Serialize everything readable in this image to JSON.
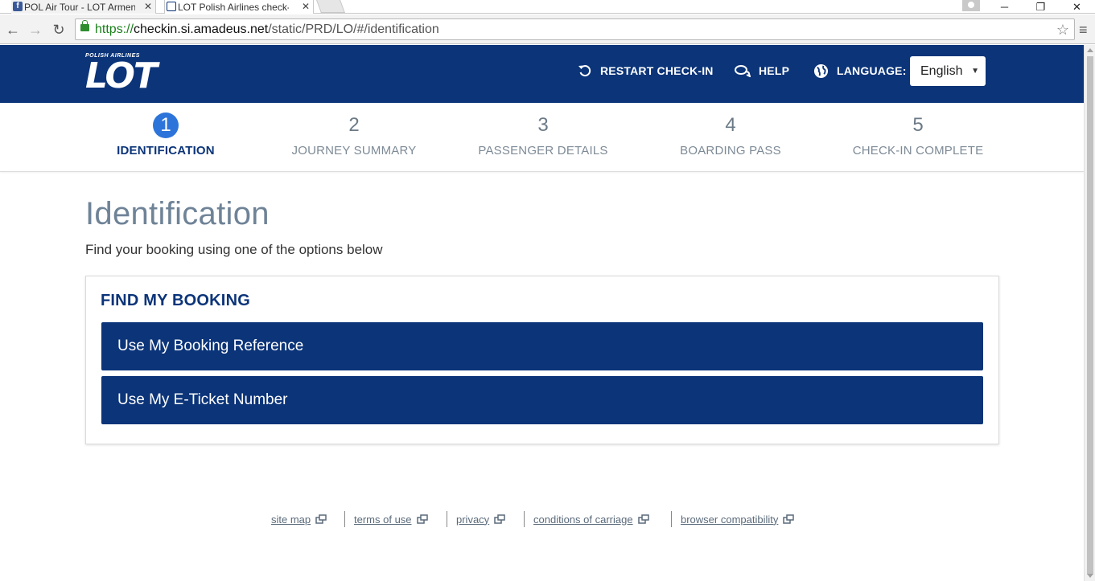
{
  "browser": {
    "tabs": [
      {
        "title": "POL Air Tour - LOT Armeni",
        "favicon": "facebook-icon"
      },
      {
        "title": "LOT Polish Airlines check-i",
        "favicon": "lot-favicon"
      }
    ],
    "url": {
      "scheme": "https://",
      "host": "checkin.si.amadeus.net",
      "path": "/static/PRD/LO/#/identification"
    }
  },
  "header": {
    "logo_top": "POLISH AIRLINES",
    "logo_main": "LOT",
    "restart_label": "RESTART CHECK-IN",
    "help_label": "HELP",
    "language_label": "LANGUAGE:",
    "language_value": "English"
  },
  "steps": [
    {
      "num": "1",
      "label": "IDENTIFICATION",
      "active": true
    },
    {
      "num": "2",
      "label": "JOURNEY SUMMARY",
      "active": false
    },
    {
      "num": "3",
      "label": "PASSENGER DETAILS",
      "active": false
    },
    {
      "num": "4",
      "label": "BOARDING PASS",
      "active": false
    },
    {
      "num": "5",
      "label": "CHECK-IN COMPLETE",
      "active": false
    }
  ],
  "main": {
    "title": "Identification",
    "subtitle": "Find your booking using one of the options below",
    "card_title": "FIND MY BOOKING",
    "options": [
      {
        "label": "Use My Booking Reference"
      },
      {
        "label": "Use My E-Ticket Number"
      }
    ]
  },
  "footer": {
    "links": [
      {
        "label": "site map"
      },
      {
        "label": "terms of use"
      },
      {
        "label": "privacy"
      },
      {
        "label": "conditions of carriage"
      },
      {
        "label": "browser compatibility"
      }
    ]
  },
  "colors": {
    "brand_navy": "#0b3479",
    "active_step": "#2d74da",
    "title_gray": "#6f8397"
  }
}
